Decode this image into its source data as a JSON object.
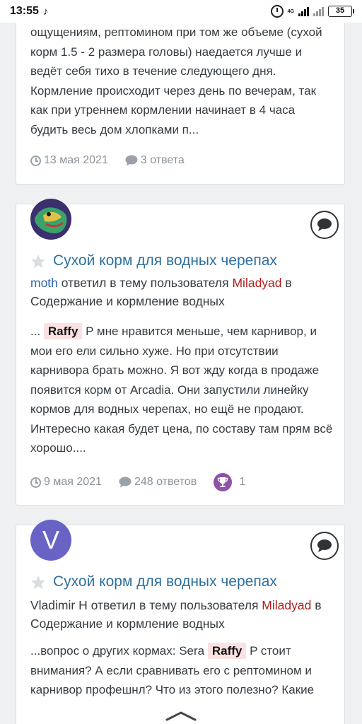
{
  "status_bar": {
    "time": "13:55",
    "network": "4G",
    "battery": "35"
  },
  "posts": [
    {
      "snippet": "ощущениям, рептомином при том же объеме (сухой корм 1.5 - 2 размера головы) наедается лучше и ведёт себя тихо в течение следующего дня. Кормление происходит через день по вечерам, так как при утреннем кормлении начинает в 4 часа будить весь дом хлопками п...",
      "date": "13 мая 2021",
      "replies": "3 ответа"
    },
    {
      "title": "Сухой корм для водных черепах",
      "user": "moth",
      "action": " ответил в тему пользователя ",
      "author": "Miladyad",
      "in_text": " в Содержание и кормление водных",
      "snippet_pre": "... ",
      "mention": "Raffy",
      "snippet_post": " P мне нравится меньше, чем карнивор, и мои его ели сильно хуже. Но при отсутствии карнивора брать можно. Я вот жду когда в продаже появится корм от Arcadia. Они запустили линейку кормов для водных черепах, но ещё не продают. Интересно какая будет цена, по составу там прям всё хорошо....",
      "date": "9 мая 2021",
      "replies": "248 ответов",
      "reactions": "1"
    },
    {
      "avatar_letter": "V",
      "title": "Сухой корм для водных черепах",
      "user": "Vladimir H",
      "action": " ответил в тему пользователя ",
      "author": "Miladyad",
      "in_text": " в Содержание и кормление водных",
      "snippet_pre": "...вопрос о других кормах: Sera ",
      "mention": "Raffy",
      "snippet_post": " P стоит внимания? А если сравнивать его с рептомином и карнивор профешнл? Что из этого полезно? Какие"
    }
  ],
  "colors": {
    "link": "#2e6f9e",
    "user_link": "#2e63b8",
    "author_link": "#b01d1d",
    "mention_bg": "#fbe2e2",
    "trophy": "#8e52a8",
    "avatar_v": "#6a63c6"
  }
}
